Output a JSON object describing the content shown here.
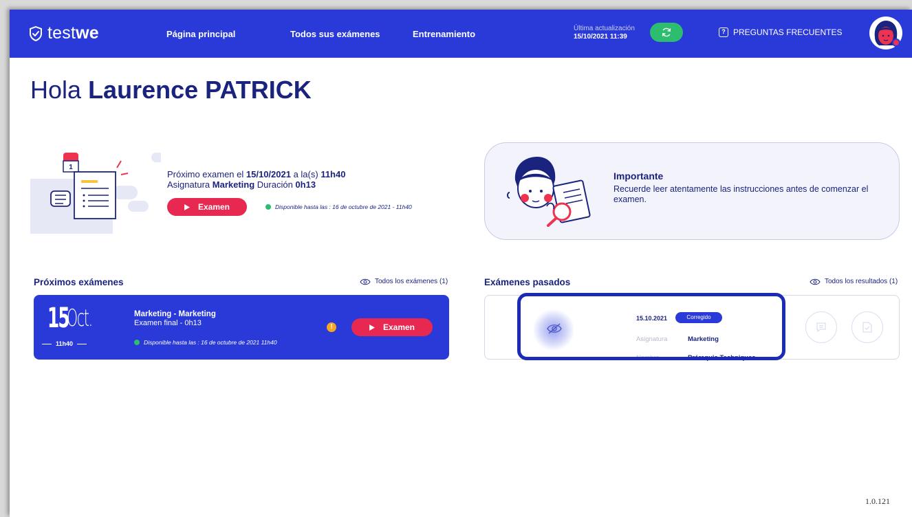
{
  "nav": {
    "logo_prefix": "test",
    "logo_suffix": "we",
    "links": [
      "Página principal",
      "Todos sus exámenes",
      "Entrenamiento"
    ],
    "update_label": "Última actualización",
    "update_value": "15/10/2021 11:39",
    "faq_label": "PREGUNTAS FRECUENTES",
    "faq_icon": "?"
  },
  "greeting": {
    "hello": "Hola",
    "name": "Laurence PATRICK"
  },
  "next_exam": {
    "line1_prefix": "Próximo examen el ",
    "date": "15/10/2021",
    "line1_mid": " a la(s) ",
    "time": "11h40",
    "line2_prefix": "Asignatura ",
    "subject": "Marketing",
    "line2_mid": " Duración ",
    "duration": "0h13",
    "button_label": "Examen",
    "availability": "Disponible hasta las : 16 de octubre de 2021 - 11h40",
    "calendar_day": "1"
  },
  "important": {
    "title": "Importante",
    "text": "Recuerde leer atentamente las instrucciones antes de comenzar el examen."
  },
  "upcoming": {
    "section_title": "Próximos exámenes",
    "link_label": "Todos los exámenes (1)",
    "day": "15",
    "month": "Oct.",
    "time": "11h40",
    "title": "Marketing - Marketing",
    "subtitle": "Examen final - 0h13",
    "availability": "Disponible hasta las : 16 de octubre de 2021 11h40",
    "info_icon": "!",
    "button_label": "Examen"
  },
  "past": {
    "section_title": "Exámenes pasados",
    "link_label": "Todos los resultados (1)",
    "date": "15.10.2021",
    "badge": "Corregido",
    "subject_label": "Asignatura",
    "subject_value": "Marketing",
    "name_label": "Nombre",
    "name_value": "Prérequis Techniques ..."
  },
  "version": "1.0.121",
  "colors": {
    "primary": "#2a3ad9",
    "accent_red": "#e72850",
    "success_green": "#2dbd6e",
    "text_navy": "#1a237e"
  }
}
